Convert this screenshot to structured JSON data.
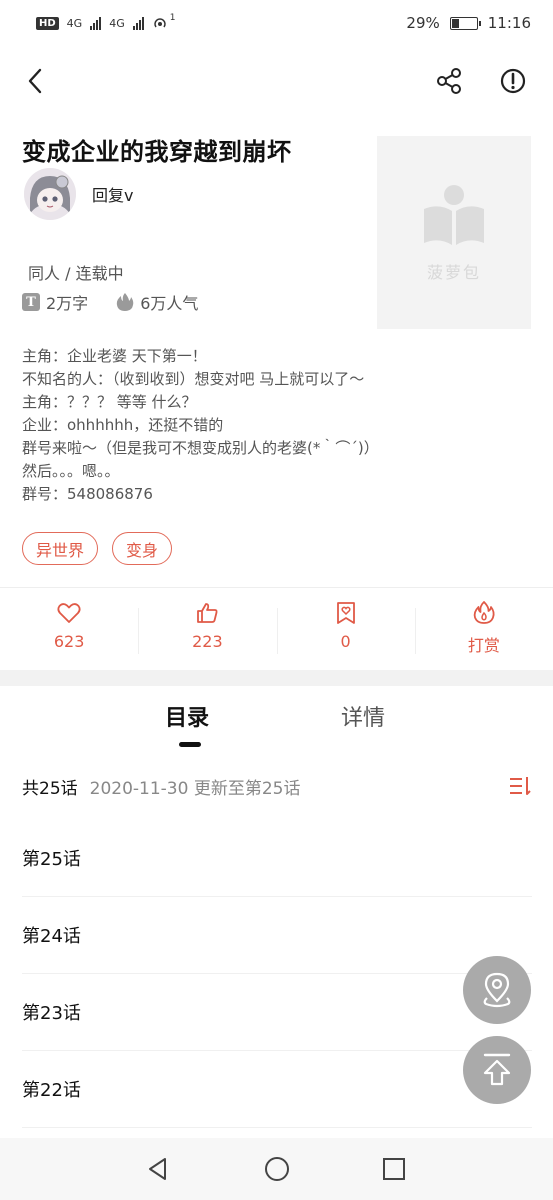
{
  "status_bar": {
    "left_indicators": [
      "HD",
      "4G",
      "4G",
      "1"
    ],
    "battery": "29%",
    "battery_level": 0.29,
    "time": "11:16"
  },
  "nav": {
    "back_icon": "chevron-left-icon",
    "share_icon": "share-icon",
    "report_icon": "exclamation-circle-icon"
  },
  "book": {
    "title": "变成企业的我穿越到崩坏",
    "author": "回复v",
    "genre": "同人 / 连载中",
    "word_count": "2万字",
    "popularity": "6万人气",
    "cover_brand": "菠萝包",
    "description": [
      "主角：企业老婆  天下第一！",
      "不知名的人：（收到收到）想变对吧 马上就可以了～",
      "主角：？？？ 等等  什么？",
      "企业：ohhhhhh，还挺不错的",
      "群号来啦～（但是我可不想变成别人的老婆(*｀⌒´)）",
      "然后。。。嗯。。",
      "群号：548086876"
    ],
    "tags": [
      "异世界",
      "变身"
    ]
  },
  "actions": [
    {
      "icon": "heart-icon",
      "label": "623"
    },
    {
      "icon": "thumbs-up-icon",
      "label": "223"
    },
    {
      "icon": "bookmark-ticket-icon",
      "label": "0"
    },
    {
      "icon": "flame-icon",
      "label": "打赏"
    }
  ],
  "tabs": {
    "catalog": "目录",
    "details": "详情"
  },
  "chapter_summary": {
    "count": "共25话",
    "updated": "2020-11-30 更新至第25话"
  },
  "chapters": [
    "第25话",
    "第24话",
    "第23话",
    "第22话"
  ],
  "colors": {
    "accent": "#e05a47",
    "fab": "#aaaaaa"
  }
}
